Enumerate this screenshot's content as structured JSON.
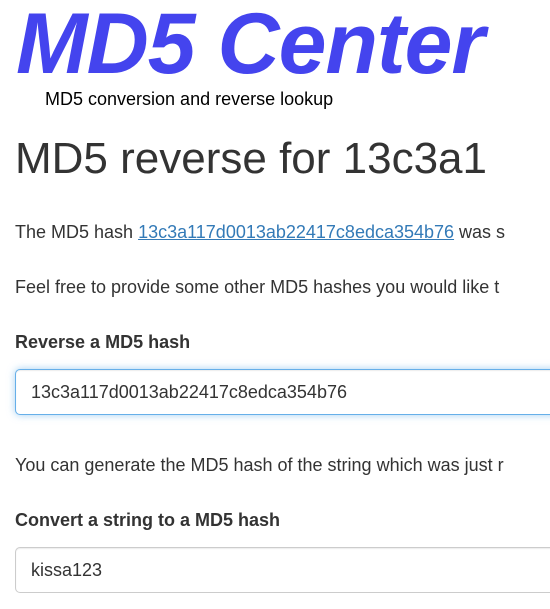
{
  "site": {
    "title": "MD5 Center",
    "tagline": "MD5 conversion and reverse lookup"
  },
  "page": {
    "heading": "MD5 reverse for 13c3a1",
    "para1_prefix": "The MD5 hash ",
    "hash_link": "13c3a117d0013ab22417c8edca354b76",
    "para1_suffix": " was s",
    "para2": "Feel free to provide some other MD5 hashes you would like t",
    "para3": "You can generate the MD5 hash of the string which was just r"
  },
  "reverse_form": {
    "label": "Reverse a MD5 hash",
    "value": "13c3a117d0013ab22417c8edca354b76"
  },
  "convert_form": {
    "label": "Convert a string to a MD5 hash",
    "value": "kissa123"
  },
  "colors": {
    "brand": "#4444ee",
    "link": "#337ab7",
    "focus_border": "#66afe9"
  }
}
